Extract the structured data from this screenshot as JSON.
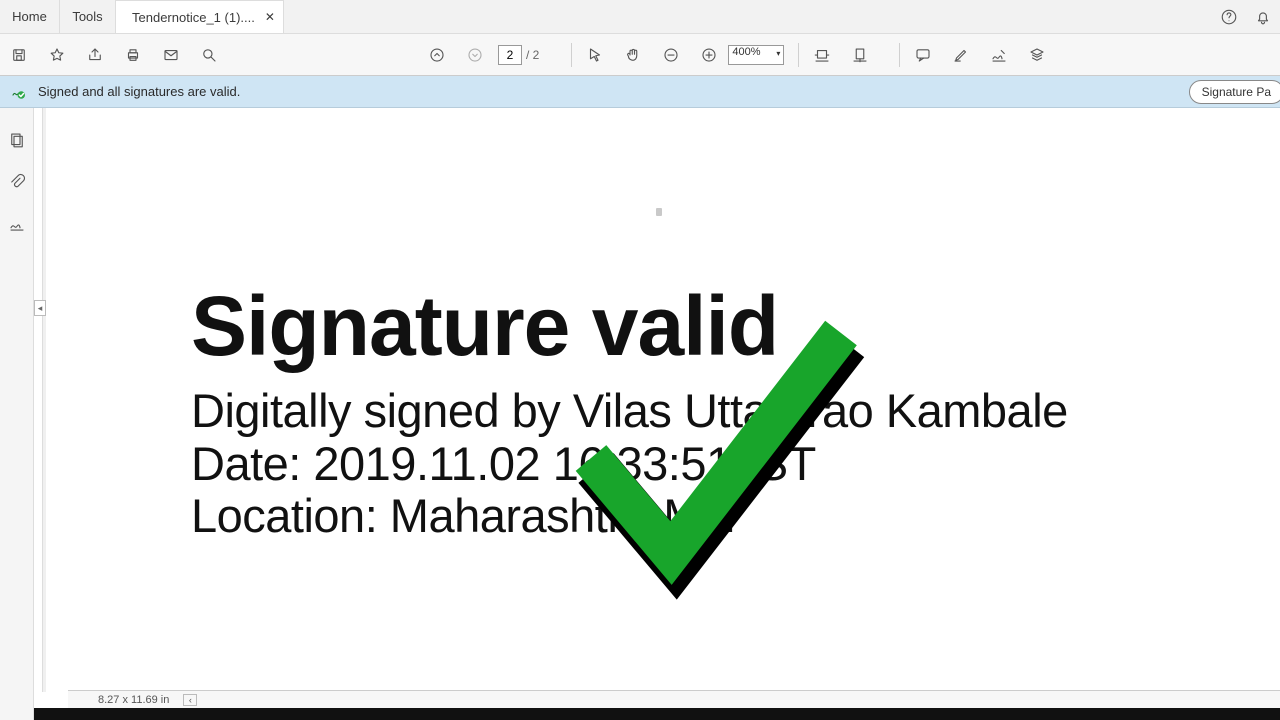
{
  "tabs": {
    "home": "Home",
    "tools": "Tools",
    "doc": "Tendernotice_1 (1)...."
  },
  "toolbar": {
    "page_current": "2",
    "page_total": "/ 2",
    "zoom": "400%"
  },
  "sigbar": {
    "msg": "Signed and all signatures are valid.",
    "panel": "Signature Pa"
  },
  "document": {
    "title": "Signature valid",
    "signed_by": "Digitally signed by Vilas Uttamrao Kambale",
    "date_line": "Date: 2019.11.02 16:33:51 IST",
    "loc_line": "Location: Maharashtra-MH"
  },
  "status": {
    "dims": "8.27 x 11.69 in"
  }
}
